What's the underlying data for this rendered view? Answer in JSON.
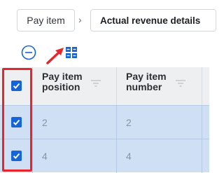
{
  "breadcrumb": {
    "items": [
      {
        "label": "Pay item"
      },
      {
        "label": "Actual revenue details"
      }
    ],
    "separator_icon": "chevron-right-icon"
  },
  "toolbar": {
    "collapse_icon": "minus-circle-icon",
    "grid_icon": "grid-settings-icon",
    "annotation": "red-arrow-icon"
  },
  "table": {
    "columns": [
      {
        "label": "Pay item position"
      },
      {
        "label": "Pay item number"
      }
    ],
    "select_all_checked": true,
    "rows": [
      {
        "checked": true,
        "cells": [
          "2",
          "2"
        ]
      },
      {
        "checked": true,
        "cells": [
          "4",
          "4"
        ]
      }
    ]
  },
  "colors": {
    "accent": "#1565d8",
    "selected_row": "#cfe0f5",
    "header_bg": "#eeeff1",
    "highlight": "#e5262d"
  }
}
